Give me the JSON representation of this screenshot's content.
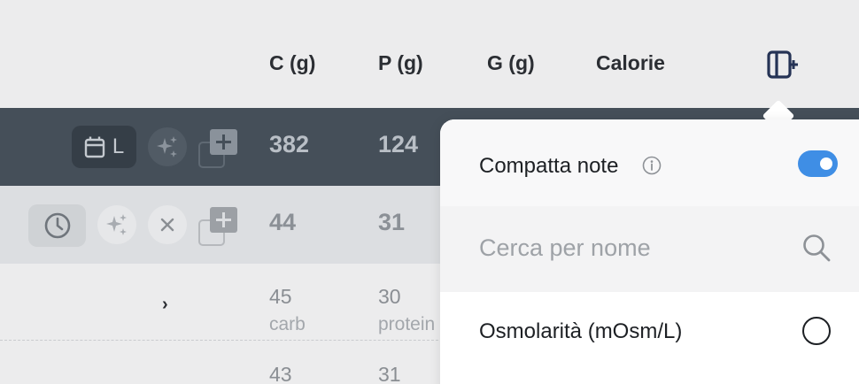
{
  "table": {
    "columns": [
      "C (g)",
      "P (g)",
      "G (g)",
      "Calorie"
    ],
    "day_row": {
      "date_chip_label": "L",
      "carbs": "382",
      "protein": "124"
    },
    "meal_row": {
      "carbs": "44",
      "protein": "31"
    },
    "item_rows": [
      {
        "carbs": "45",
        "carbs_unit": "carb",
        "protein": "30",
        "protein_unit": "protein"
      },
      {
        "carbs": "43",
        "protein": "31"
      }
    ],
    "expand_chevron": "›"
  },
  "popup": {
    "compact_notes_label": "Compatta note",
    "compact_notes_on": true,
    "search_placeholder": "Cerca per nome",
    "option_label": "Osmolarità (mOsm/L)"
  },
  "colors": {
    "accent": "#3f8ee5",
    "dark_row": "#454f59"
  },
  "icons": [
    "panel-add-icon",
    "calendar-icon",
    "sparkles-icon",
    "copy-add-icon",
    "clock-icon",
    "close-icon",
    "info-icon",
    "search-icon"
  ]
}
